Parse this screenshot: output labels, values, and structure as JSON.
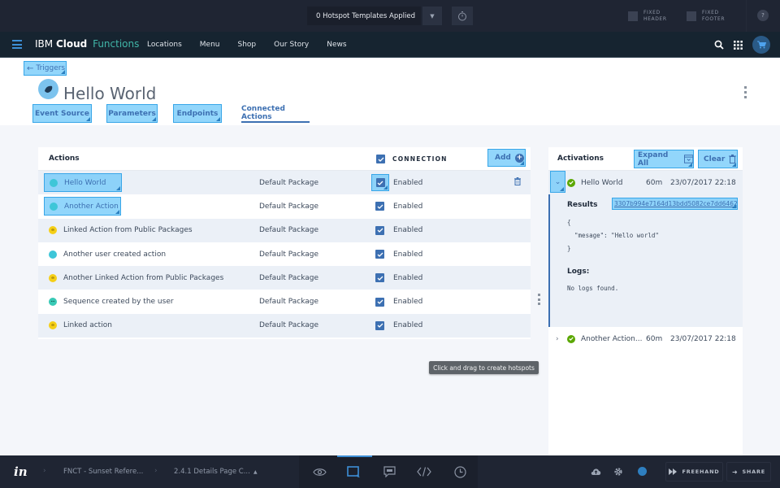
{
  "invision_top": {
    "hotspot_templates": "0 Hotspot Templates Applied",
    "fixed_header": [
      "FIXED",
      "HEADER"
    ],
    "fixed_footer": [
      "FIXED",
      "FOOTER"
    ],
    "help": "?"
  },
  "masthead": {
    "brand_ibm": "IBM",
    "brand_cloud": "Cloud",
    "brand_functions": "Functions",
    "nav": [
      "Locations",
      "Menu",
      "Shop",
      "Our Story",
      "News"
    ]
  },
  "page": {
    "back_label": "Triggers",
    "title": "Hello World",
    "tabs": [
      {
        "label": "Event Source",
        "active": false
      },
      {
        "label": "Parameters",
        "active": false
      },
      {
        "label": "Endpoints",
        "active": false
      },
      {
        "label": "Connected Actions",
        "active": true
      }
    ]
  },
  "actions": {
    "title": "Actions",
    "connection_label": "CONNECTION",
    "add_label": "Add",
    "rows": [
      {
        "name": "Hello World",
        "type": "code",
        "package": "Default Package",
        "status": "Enabled",
        "checked": true
      },
      {
        "name": "Another Action",
        "type": "code",
        "package": "Default Package",
        "status": "Enabled",
        "checked": true
      },
      {
        "name": "Linked Action from Public Packages",
        "type": "link",
        "package": "Default Package",
        "status": "Enabled",
        "checked": true
      },
      {
        "name": "Another user created action",
        "type": "code",
        "package": "Default Package",
        "status": "Enabled",
        "checked": true
      },
      {
        "name": "Another Linked Action from Public Packages",
        "type": "link",
        "package": "Default Package",
        "status": "Enabled",
        "checked": true
      },
      {
        "name": "Sequence created by the user",
        "type": "sequence",
        "package": "Default Package",
        "status": "Enabled",
        "checked": true
      },
      {
        "name": "Linked action",
        "type": "link",
        "package": "Default Package",
        "status": "Enabled",
        "checked": true
      }
    ]
  },
  "activations": {
    "title": "Activations",
    "expand_all_label": "Expand All",
    "clear_label": "Clear",
    "items": [
      {
        "name": "Hello World",
        "duration": "60m",
        "timestamp": "23/07/2017 22:18",
        "expanded": true
      },
      {
        "name": "Another Action...",
        "duration": "60m",
        "timestamp": "23/07/2017 22:18",
        "expanded": false
      }
    ],
    "detail": {
      "results_label": "Results",
      "activation_id": "3307b994e7164d13bdd5082ce7dd6462",
      "result_json": "{\n  \"mesage\": \"Hello world\"\n}",
      "logs_label": "Logs:",
      "logs_value": "No logs found."
    }
  },
  "tooltip": "Click and drag to create hotspots",
  "invision_bottom": {
    "project": "FNCT - Sunset Refere...",
    "screen": "2.4.1 Details Page C...",
    "freehand_label": "FREEHAND",
    "share_label": "SHARE"
  },
  "colors": {
    "accent": "#3d70b2",
    "brand_functions": "#41b6a8",
    "success": "#5aa700",
    "hotspot": "#6ec8fa"
  }
}
